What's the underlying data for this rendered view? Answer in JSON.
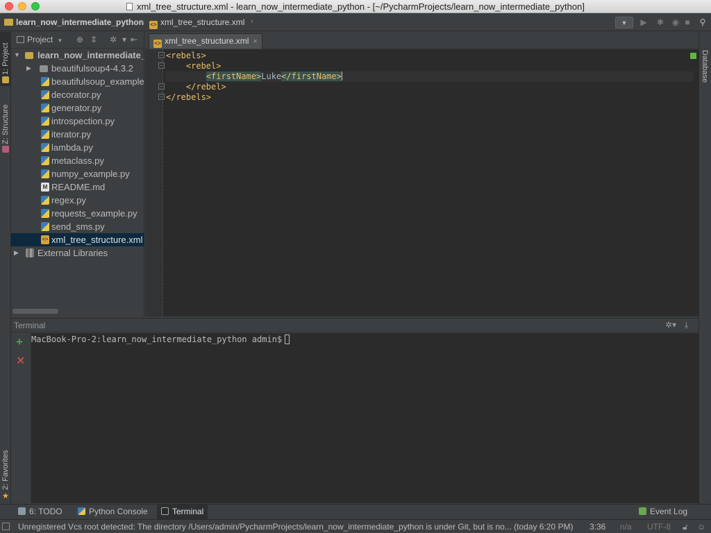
{
  "window": {
    "title": "xml_tree_structure.xml - learn_now_intermediate_python - [~/PycharmProjects/learn_now_intermediate_python]"
  },
  "navbar": {
    "project": "learn_now_intermediate_python",
    "file": "xml_tree_structure.xml"
  },
  "left_stripe": {
    "project_tab": "1: Project",
    "structure_tab": "Z: Structure",
    "favorites_tab": "2: Favorites"
  },
  "right_stripe": {
    "database_tab": "Database"
  },
  "project_panel": {
    "view_label": "Project",
    "items": [
      {
        "label": "learn_now_intermediate_",
        "type": "root-folder"
      },
      {
        "label": "beautifulsoup4-4.3.2",
        "type": "folder"
      },
      {
        "label": "beautifulsoup_example",
        "type": "py"
      },
      {
        "label": "decorator.py",
        "type": "py"
      },
      {
        "label": "generator.py",
        "type": "py"
      },
      {
        "label": "introspection.py",
        "type": "py"
      },
      {
        "label": "iterator.py",
        "type": "py"
      },
      {
        "label": "lambda.py",
        "type": "py"
      },
      {
        "label": "metaclass.py",
        "type": "py"
      },
      {
        "label": "numpy_example.py",
        "type": "py"
      },
      {
        "label": "README.md",
        "type": "md"
      },
      {
        "label": "regex.py",
        "type": "py"
      },
      {
        "label": "requests_example.py",
        "type": "py"
      },
      {
        "label": "send_sms.py",
        "type": "py"
      },
      {
        "label": "xml_tree_structure.xml",
        "type": "xml"
      },
      {
        "label": "External Libraries",
        "type": "lib"
      }
    ]
  },
  "editor": {
    "tab_label": "xml_tree_structure.xml",
    "lines": {
      "l1": "<rebels>",
      "l2": "<rebel>",
      "l3_open": "<firstName>",
      "l3_text": "Luke",
      "l3_close": "</firstName>",
      "l4": "</rebel>",
      "l5": "</rebels>"
    }
  },
  "terminal": {
    "title": "Terminal",
    "prompt": "MacBook-Pro-2:learn_now_intermediate_python admin$"
  },
  "bottom_tabs": {
    "todo": "6: TODO",
    "python_console": "Python Console",
    "terminal": "Terminal",
    "event_log": "Event Log"
  },
  "statusbar": {
    "message": "Unregistered Vcs root detected: The directory /Users/admin/PycharmProjects/learn_now_intermediate_python is under Git, but is no... (today 6:20 PM)",
    "position": "3:36",
    "line_separator": "n/a",
    "encoding": "UTF-8"
  }
}
